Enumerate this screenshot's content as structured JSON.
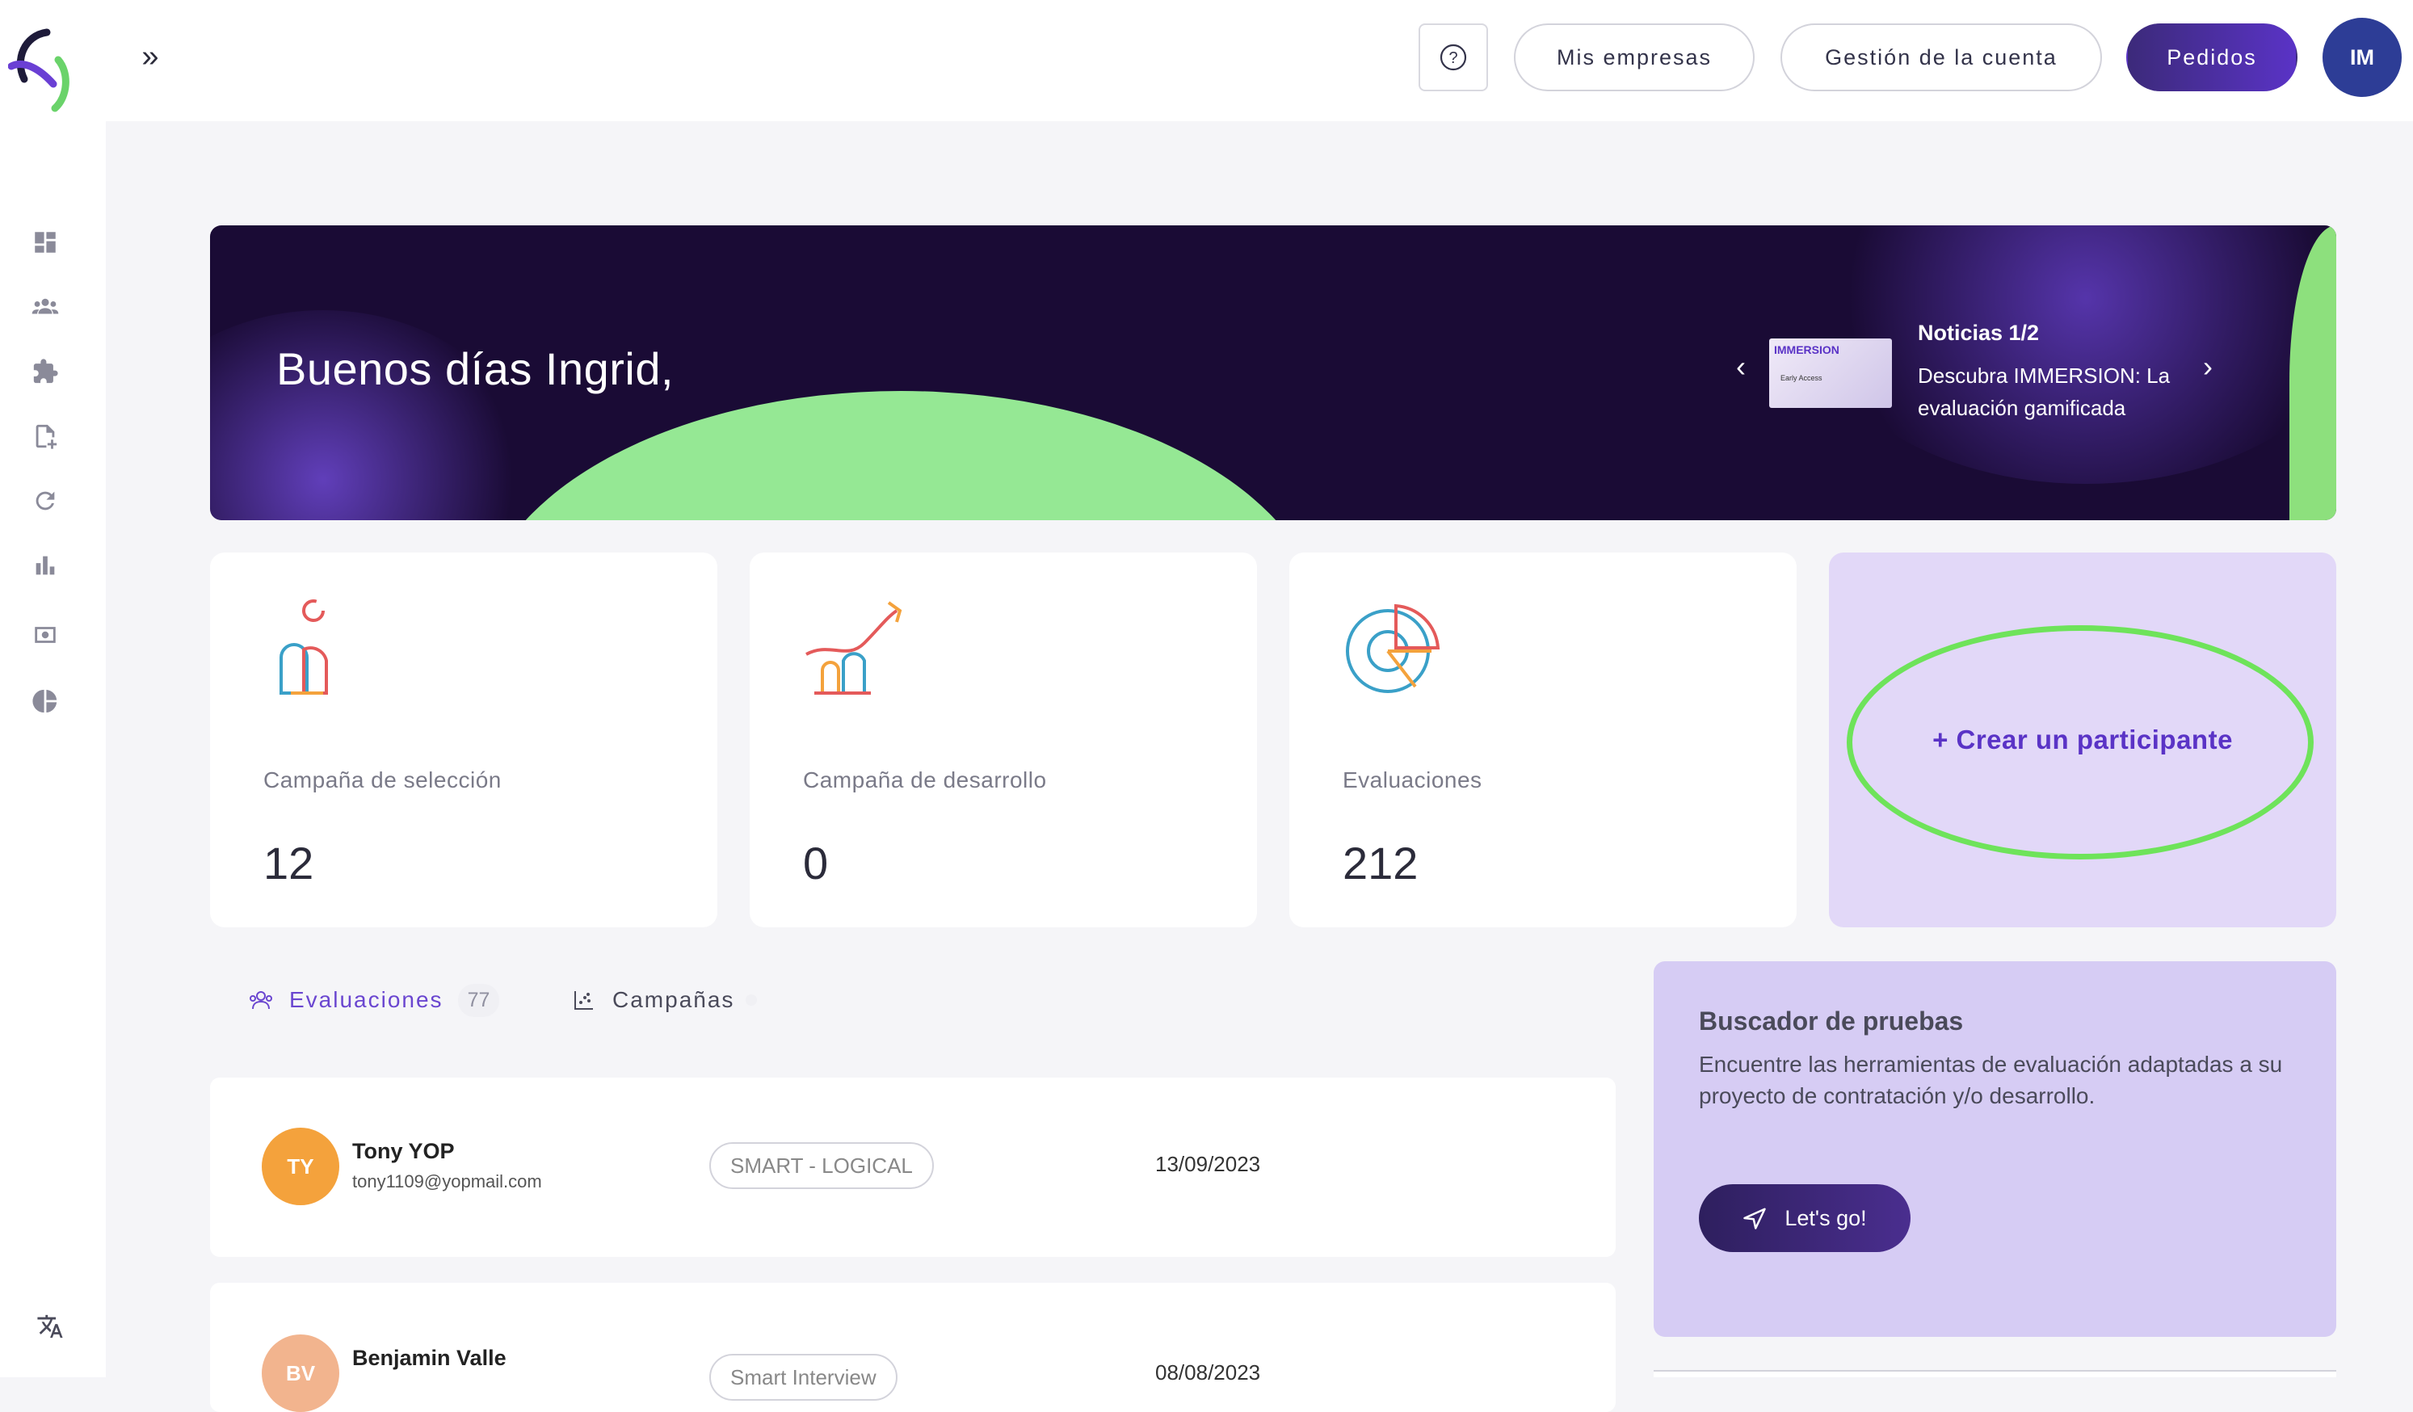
{
  "topbar": {
    "expand_label": "»",
    "help_label": "?",
    "my_companies": "Mis empresas",
    "account_management": "Gestión de la cuenta",
    "orders": "Pedidos",
    "user_initials": "IM"
  },
  "sidebar": {
    "items": [
      {
        "icon": "dashboard-icon"
      },
      {
        "icon": "users-icon"
      },
      {
        "icon": "puzzle-icon"
      },
      {
        "icon": "add-document-icon"
      },
      {
        "icon": "refresh-icon"
      },
      {
        "icon": "bar-chart-icon"
      },
      {
        "icon": "screen-icon"
      },
      {
        "icon": "pie-chart-icon"
      },
      {
        "icon": "translate-icon"
      }
    ]
  },
  "banner": {
    "greeting": "Buenos días Ingrid,",
    "news_title": "Noticias 1/2",
    "news_text": "Descubra IMMERSION: La evaluación gamificada",
    "thumb_title": "IMMERSION",
    "thumb_sub": "Early Access"
  },
  "cards": [
    {
      "label": "Campaña de selección",
      "value": "12"
    },
    {
      "label": "Campaña de desarrollo",
      "value": "0"
    },
    {
      "label": "Evaluaciones",
      "value": "212"
    }
  ],
  "create_participant": "+ Crear un participante",
  "tabs": {
    "evaluations_label": "Evaluaciones",
    "evaluations_count": "77",
    "campaigns_label": "Campañas"
  },
  "rows": [
    {
      "initials": "TY",
      "name": "Tony YOP",
      "email": "tony1109@yopmail.com",
      "tag": "SMART - LOGICAL",
      "date": "13/09/2023",
      "color": "#f4a23c"
    },
    {
      "initials": "BV",
      "name": "Benjamin Valle",
      "email": "",
      "tag": "Smart Interview",
      "date": "08/08/2023",
      "color": "#f2b48e"
    }
  ],
  "search_panel": {
    "title": "Buscador de pruebas",
    "description": "Encuentre las herramientas de evaluación adaptadas a su proyecto de contratación y/o desarrollo.",
    "button": "Let's go!"
  },
  "colors": {
    "accent": "#5a33c6",
    "highlight_ring": "#6ee35a",
    "banner_bg": "#1a0b35"
  }
}
